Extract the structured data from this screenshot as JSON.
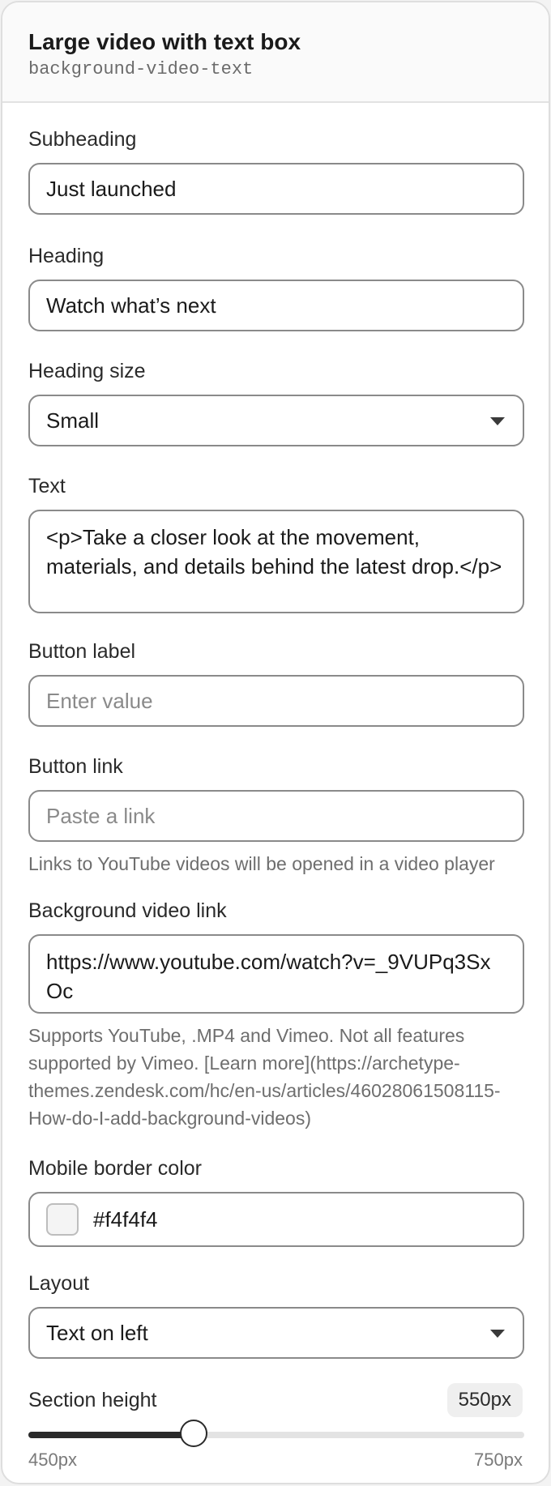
{
  "header": {
    "title": "Large video with text box",
    "section_id": "background-video-text"
  },
  "fields": {
    "subheading": {
      "label": "Subheading",
      "value": "Just launched"
    },
    "heading": {
      "label": "Heading",
      "value": "Watch what’s next"
    },
    "heading_size": {
      "label": "Heading size",
      "value": "Small"
    },
    "text": {
      "label": "Text",
      "value": "<p>Take a closer look at the movement, materials, and details behind the latest drop.</p>"
    },
    "button_label": {
      "label": "Button label",
      "value": "",
      "placeholder": "Enter value"
    },
    "button_link": {
      "label": "Button link",
      "value": "",
      "placeholder": "Paste a link",
      "help": "Links to YouTube videos will be opened in a video player"
    },
    "video_link": {
      "label": "Background video link",
      "value": "https://www.youtube.com/watch?v=_9VUPq3SxOc",
      "help": "Supports YouTube, .MP4 and Vimeo. Not all features supported by Vimeo. [Learn more](https://archetype-themes.zendesk.com/hc/en-us/articles/46028061508115-How-do-I-add-background-videos)"
    },
    "mobile_border_color": {
      "label": "Mobile border color",
      "value": "#f4f4f4"
    },
    "layout": {
      "label": "Layout",
      "value": "Text on left"
    },
    "section_height": {
      "label": "Section height",
      "value_label": "550px",
      "value": 550,
      "min": 450,
      "max": 750,
      "min_label": "450px",
      "max_label": "750px"
    }
  },
  "colors": {
    "swatch": "#f4f4f4",
    "slider_fill": "#2a2a2a"
  }
}
